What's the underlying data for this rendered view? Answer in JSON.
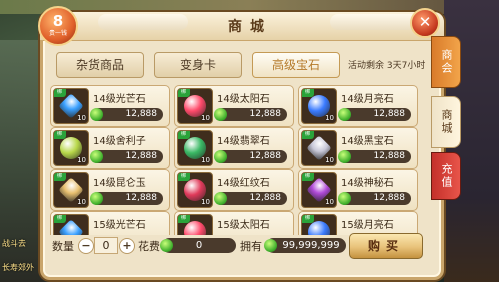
{
  "window": {
    "title": "商城"
  },
  "vip": {
    "level": "8",
    "label": "贵一钱"
  },
  "tabs": [
    {
      "label": "杂货商品",
      "active": false
    },
    {
      "label": "变身卡",
      "active": false
    },
    {
      "label": "高级宝石",
      "active": true
    }
  ],
  "activity": "活动剩余 3天7小时",
  "items": [
    {
      "name": "14级光芒石",
      "price": "12,888",
      "badge": "绑",
      "count": "10",
      "color": "#3aa0ff",
      "shape": "diamond"
    },
    {
      "name": "14级太阳石",
      "price": "12,888",
      "badge": "绑",
      "count": "10",
      "color": "#ff4a6a",
      "shape": "circle"
    },
    {
      "name": "14级月亮石",
      "price": "12,888",
      "badge": "绑",
      "count": "10",
      "color": "#3a7bff",
      "shape": "moon"
    },
    {
      "name": "14级舍利子",
      "price": "12,888",
      "badge": "绑",
      "count": "10",
      "color": "#b8d84a",
      "shape": "circle"
    },
    {
      "name": "14级翡翠石",
      "price": "12,888",
      "badge": "绑",
      "count": "10",
      "color": "#3ab864",
      "shape": "circle"
    },
    {
      "name": "14级黑宝石",
      "price": "12,888",
      "badge": "绑",
      "count": "10",
      "color": "#c8c8d8",
      "shape": "diamond"
    },
    {
      "name": "14级昆仑玉",
      "price": "12,888",
      "badge": "绑",
      "count": "10",
      "color": "#e8c070",
      "shape": "diamond"
    },
    {
      "name": "14级红纹石",
      "price": "12,888",
      "badge": "绑",
      "count": "10",
      "color": "#e03a5a",
      "shape": "circle"
    },
    {
      "name": "14级神秘石",
      "price": "12,888",
      "badge": "绑",
      "count": "10",
      "color": "#b04ad8",
      "shape": "diamond"
    },
    {
      "name": "15级光芒石",
      "price": "",
      "badge": "绑",
      "count": "",
      "color": "#3aa0ff",
      "shape": "diamond"
    },
    {
      "name": "15级太阳石",
      "price": "",
      "badge": "绑",
      "count": "",
      "color": "#ff4a6a",
      "shape": "circle"
    },
    {
      "name": "15级月亮石",
      "price": "",
      "badge": "绑",
      "count": "",
      "color": "#3a7bff",
      "shape": "moon"
    }
  ],
  "bottom": {
    "quantity_label": "数量",
    "quantity_value": "0",
    "minus": "−",
    "plus": "+",
    "cost_label": "花费",
    "cost_value": "0",
    "owned_label": "拥有",
    "owned_value": "99,999,999",
    "buy_label": "购买"
  },
  "side_tabs": [
    {
      "label": "商会"
    },
    {
      "label": "商城"
    },
    {
      "label": "充值"
    }
  ],
  "close_label": "✕",
  "left_edge": [
    "战斗去",
    "长寿郊外"
  ],
  "colors": {
    "accent": "#c9a56b",
    "coin": "#3fae2c",
    "active_tab_text": "#b57a2a"
  }
}
